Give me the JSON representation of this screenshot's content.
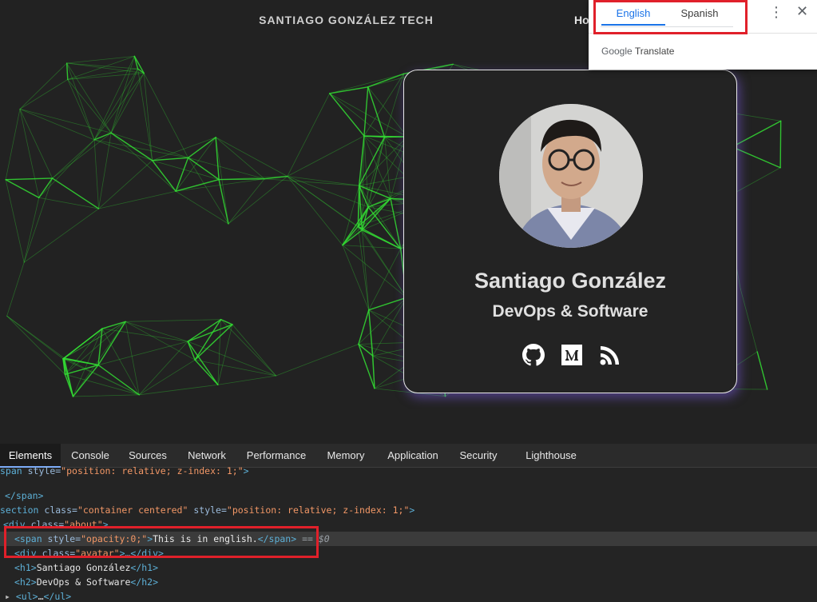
{
  "site": {
    "title": "SANTIAGO GONZÁLEZ TECH",
    "nav_partial": "Ho",
    "card": {
      "name": "Santiago González",
      "role": "DevOps & Software"
    },
    "social_icons": [
      "github-icon",
      "medium-icon",
      "rss-icon"
    ]
  },
  "translate_popup": {
    "tabs": [
      "English",
      "Spanish"
    ],
    "active_tab": "English",
    "brand_google": "Google",
    "brand_translate": "Translate",
    "menu_glyph": "⋮",
    "close_glyph": "✕"
  },
  "devtools": {
    "tabs": [
      "Elements",
      "Console",
      "Sources",
      "Network",
      "Performance",
      "Memory",
      "Application",
      "Security",
      "Lighthouse"
    ],
    "active_tab": "Elements",
    "lines": {
      "l0_tag": "span ",
      "l0_attr": "style=",
      "l0_val": "\"position: relative; z-index: 1;\"",
      "l1_close": "</span>",
      "l2_tag": "section ",
      "l2_attr1": "class=",
      "l2_val1": "\"container centered\"",
      "l2_attr2": " style=",
      "l2_val2": "\"position: relative; z-index: 1;\"",
      "l3_tag": "<div ",
      "l3_attr": "class=",
      "l3_val": "\"about\"",
      "l4_open": "<span ",
      "l4_attr": "style=",
      "l4_val": "\"opacity:0;\"",
      "l4_text": "This is in english.",
      "l4_close": "</span>",
      "l4_eq": " == $0",
      "l5_tag": "<div ",
      "l5_attr": "class=",
      "l5_val": "\"avatar\"",
      "l5_rest": ">…</div>",
      "l6_open": "<h1>",
      "l6_text": "Santiago González",
      "l6_close": "</h1>",
      "l7_open": "<h2>",
      "l7_text": "DevOps & Software",
      "l7_close": "</h2>",
      "l8_open": "<ul>",
      "l8_text": "…",
      "l8_close": "</ul>"
    }
  },
  "colors": {
    "background": "#222222",
    "network_green": "#33dd33",
    "highlight_red": "#e0202a",
    "card_glow": "#7a5cdc"
  }
}
